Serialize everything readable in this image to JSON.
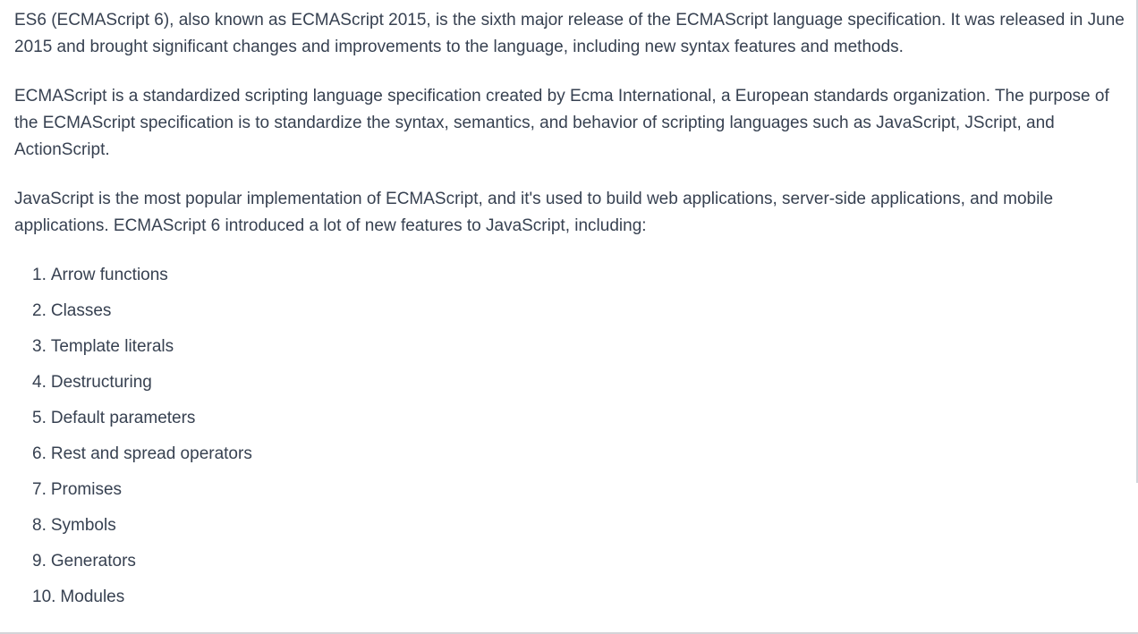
{
  "message": {
    "paragraphs": [
      "ES6 (ECMAScript 6), also known as ECMAScript 2015, is the sixth major release of the ECMAScript language specification. It was released in June 2015 and brought significant changes and improvements to the language, including new syntax features and methods.",
      "ECMAScript is a standardized scripting language specification created by Ecma International, a European standards organization. The purpose of the ECMAScript specification is to standardize the syntax, semantics, and behavior of scripting languages such as JavaScript, JScript, and ActionScript.",
      "JavaScript is the most popular implementation of ECMAScript, and it's used to build web applications, server-side applications, and mobile applications. ECMAScript 6 introduced a lot of new features to JavaScript, including:"
    ],
    "list": [
      {
        "num": "1.",
        "text": "Arrow functions"
      },
      {
        "num": "2.",
        "text": "Classes"
      },
      {
        "num": "3.",
        "text": "Template literals"
      },
      {
        "num": "4.",
        "text": "Destructuring"
      },
      {
        "num": "5.",
        "text": "Default parameters"
      },
      {
        "num": "6.",
        "text": "Rest and spread operators"
      },
      {
        "num": "7.",
        "text": "Promises"
      },
      {
        "num": "8.",
        "text": "Symbols"
      },
      {
        "num": "9.",
        "text": "Generators"
      },
      {
        "num": "10.",
        "text": "Modules"
      }
    ]
  },
  "colors": {
    "text": "#374151",
    "background": "#ffffff",
    "divider": "#d4d4d8"
  }
}
